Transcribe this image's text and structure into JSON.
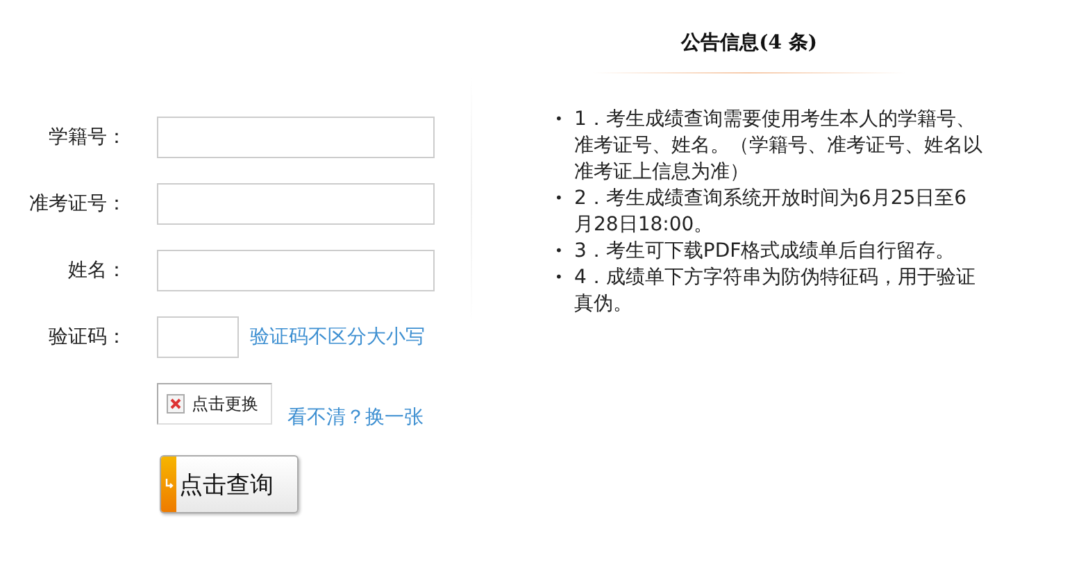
{
  "form": {
    "fields": [
      {
        "label": "学籍号：",
        "kind": "text"
      },
      {
        "label": "准考证号：",
        "kind": "text"
      },
      {
        "label": "姓名：",
        "kind": "text"
      },
      {
        "label": "验证码：",
        "kind": "captcha",
        "hint": "验证码不区分大小写"
      }
    ],
    "captcha_image": {
      "alt": "点击更换"
    },
    "refresh_link": "看不清？换一张",
    "submit": "点击查询"
  },
  "notices": {
    "title": "公告信息(4 条)",
    "items": [
      {
        "bullet": "•",
        "text": "1．考生成绩查询需要使用考生本人的学籍号、准考证号、姓名。（学籍号、准考证号、姓名以准考证上信息为准）"
      },
      {
        "bullet": "•",
        "text": "2．考生成绩查询系统开放时间为6月25日至6月28日18:00。"
      },
      {
        "bullet": "•",
        "text": "3．考生可下载PDF格式成绩单后自行留存。"
      },
      {
        "bullet": "•",
        "text": "4．成绩单下方字符串为防伪特征码，用于验证真伪。"
      }
    ]
  }
}
